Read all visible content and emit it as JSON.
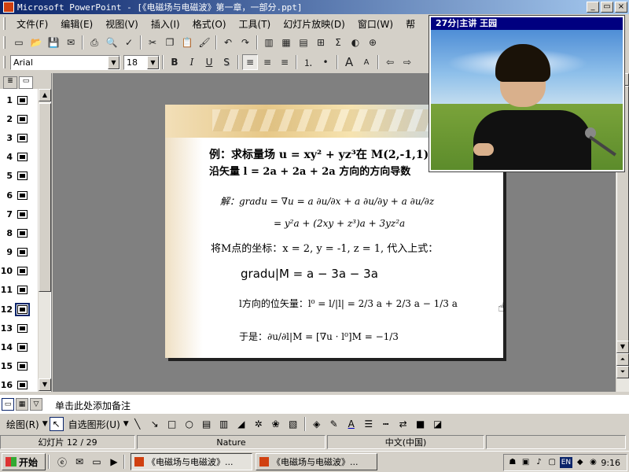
{
  "window": {
    "title": "Microsoft PowerPoint - [《电磁场与电磁波》第一章，一部分.ppt]",
    "buttons": [
      "_",
      "▭",
      "×"
    ]
  },
  "menu": {
    "items": [
      "文件(F)",
      "编辑(E)",
      "视图(V)",
      "插入(I)",
      "格式(O)",
      "工具(T)",
      "幻灯片放映(D)",
      "窗口(W)",
      "帮"
    ]
  },
  "format": {
    "font": "Arial",
    "size": "18",
    "bold": "B",
    "italic": "I",
    "underline": "U",
    "shadow": "S"
  },
  "slides_pane": {
    "numbers": [
      "1",
      "2",
      "3",
      "4",
      "5",
      "6",
      "7",
      "8",
      "9",
      "10",
      "11",
      "12",
      "13",
      "14",
      "15",
      "16"
    ],
    "current": "12"
  },
  "slide": {
    "title_line1": "例：求标量场 u = xy² + yz³在 M(2,-1,1)处",
    "title_line2": "沿矢量  l = 2a + 2a + 2a      方向的方向导数",
    "solution_line1": "解：gradu = ∇u = a ∂u/∂x + a ∂u/∂y + a ∂u/∂z",
    "solution_line2": "= y²a + (2xy + z³)a + 3yz²a",
    "coord_line": "将M点的坐标：x = 2, y = -1, z = 1, 代入上式：",
    "grad_line": "gradu|M = a − 3a − 3a",
    "direction_line": "l方向的位矢量：l⁰ = l/|l| = 2/3 a + 2/3 a − 1/3 a",
    "result_line": "于是：∂u/∂l|M = [∇u · l⁰]M = −1/3"
  },
  "video": {
    "caption": "27分|主讲  王园"
  },
  "notes": {
    "placeholder": "单击此处添加备注"
  },
  "drawing": {
    "draw_label": "绘图(R)",
    "autoshape_label": "自选图形(U)"
  },
  "status": {
    "slide_info": "幻灯片 12 / 29",
    "design": "Nature",
    "language": "中文(中国)"
  },
  "taskbar": {
    "start": "开始",
    "tasks": [
      "《电磁场与电磁波》...",
      "《电磁场与电磁波》..."
    ],
    "tray_lang": "EN",
    "clock": "9:16"
  }
}
